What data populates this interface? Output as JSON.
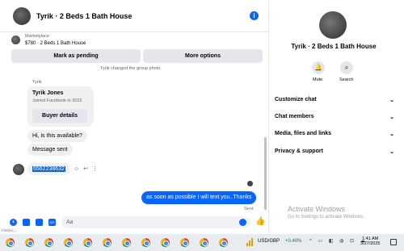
{
  "conversation": {
    "title": "Tyrik · 2 Beds 1 Bath House",
    "marketplace_label": "Marketplace",
    "listing": "$780 · 2 Beds 1 Bath House",
    "mark_pending": "Mark as pending",
    "more_options": "More options",
    "group_note": "Tyrik changed the group photo.",
    "sender_name": "Tyrik",
    "profile_card": {
      "name": "Tyrik Jones",
      "joined": "Joined Facebook in 2022",
      "button": "Buyer details"
    },
    "messages_in": [
      "Hi, is this available?",
      "Message sent",
      "6562238632"
    ],
    "message_out": "as soon as possible I will text you..Thanks",
    "sent_status": "Sent",
    "composer_placeholder": "Aa"
  },
  "panel": {
    "title": "Tyrik · 2 Beds 1 Bath House",
    "mute": "Mute",
    "search": "Search",
    "sections": [
      "Customize chat",
      "Chat members",
      "Media, files and links",
      "Privacy & support"
    ]
  },
  "watermark": {
    "title": "Activate Windows",
    "subtitle": "Go to Settings to activate Windows."
  },
  "taskbar": {
    "tooltip": "Firefox...",
    "ticker": "USD/GBP",
    "change": "+0.40%",
    "time": "1:41 AM",
    "date": "3/27/2025"
  },
  "colors": {
    "accent": "#0866ff",
    "bubble_in": "#f0f0f0"
  }
}
